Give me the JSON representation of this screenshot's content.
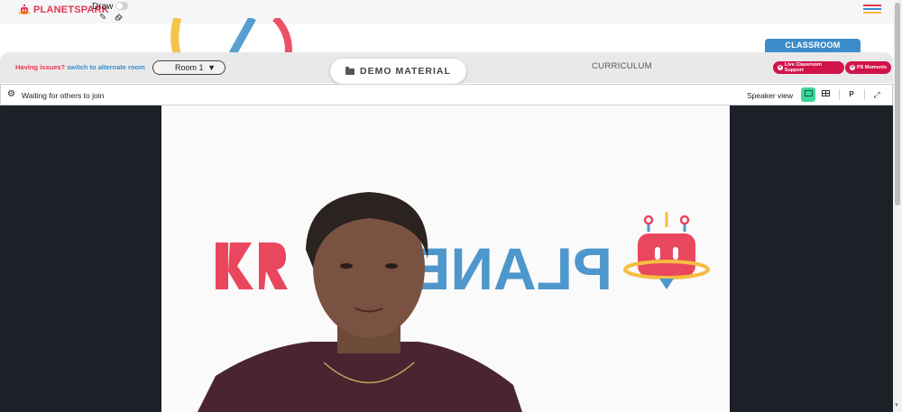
{
  "brand": {
    "name": "PLANETSPARK"
  },
  "topbar": {
    "draw_label": "Draw",
    "draw_enabled": false
  },
  "toolbar": {
    "issues_question": "Having issues?",
    "issues_link": "switch to alternate room",
    "room_selected": "Room 1",
    "demo_material": "DEMO MATERIAL",
    "curriculum": "CURRICULUM",
    "classroom_tab": "CLASSROOM",
    "live_support": "Live Classroom Support",
    "ps_moments": "PS Moments"
  },
  "video_panel": {
    "status": "Waiting for others to join",
    "speaker_view_label": "Speaker view",
    "presenter_button": "P",
    "active_layout": "speaker"
  },
  "colors": {
    "brand_red": "#e8344e",
    "brand_blue": "#3c8dc9",
    "brand_yellow": "#f5b82e",
    "accent_green": "#3bd59a",
    "pill_red": "#d0144a",
    "video_bg": "#1c2128"
  },
  "icons": [
    "robot-logo-icon",
    "pencil-icon",
    "eraser-icon",
    "hamburger-menu-icon",
    "folder-icon",
    "close-circle-icon",
    "gear-icon",
    "speaker-layout-icon",
    "grid-layout-icon",
    "fullscreen-icon"
  ]
}
